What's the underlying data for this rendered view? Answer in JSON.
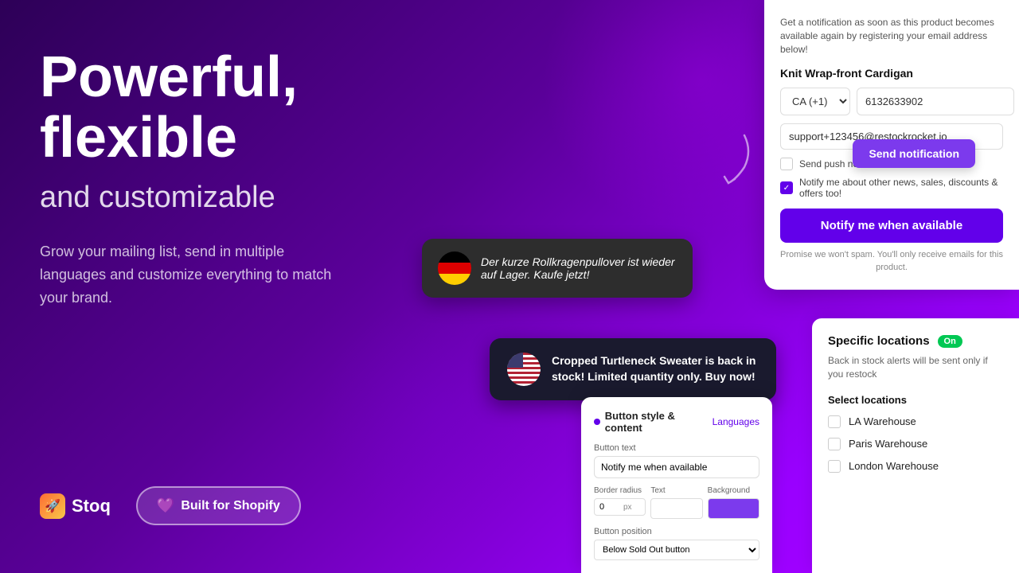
{
  "hero": {
    "title_line1": "Powerful,",
    "title_line2": "flexible",
    "subtitle": "and customizable",
    "description": "Grow your mailing list, send in multiple languages and customize everything to match your brand.",
    "stoq_label": "Stoq",
    "shopify_btn": "Built for Shopify"
  },
  "notification_form": {
    "description": "Get a notification as soon as this product becomes available again by registering your email address below!",
    "product_name": "Knit Wrap-front Cardigan",
    "phone_country": "CA (+1)",
    "phone_number": "6132633902",
    "email_placeholder": "support+123456@restockrocket.io",
    "push_notification_label": "Send push notification",
    "newsletter_label": "Notify me about other news, sales, discounts & offers too!",
    "notify_btn": "Notify me when available",
    "spam_text": "Promise we won't spam. You'll only receive emails for this product."
  },
  "send_notification_btn": "Send notification",
  "bubble_de": {
    "text": "Der kurze Rollkragenpullover ist wieder auf Lager. Kaufe jetzt!"
  },
  "bubble_en": {
    "text": "Cropped Turtleneck Sweater is back in stock! Limited quantity only. Buy now!"
  },
  "button_style_card": {
    "header": "Button style & content",
    "languages_link": "Languages",
    "button_text_label": "Button text",
    "button_text_value": "Notify me when available",
    "border_radius_label": "Border radius",
    "border_radius_value": "0",
    "border_radius_unit": "px",
    "text_label": "Text",
    "background_label": "Background",
    "button_position_label": "Button position",
    "button_position_value": "Below Sold Out button"
  },
  "locations_card": {
    "title": "Specific locations",
    "status": "On",
    "description": "Back in stock alerts will be sent only if you restock",
    "select_label": "Select locations",
    "locations": [
      {
        "name": "LA Warehouse"
      },
      {
        "name": "Paris Warehouse"
      },
      {
        "name": "London Warehouse"
      }
    ]
  },
  "colors": {
    "purple": "#6200ea",
    "light_purple": "#7c3aed",
    "green": "#00c853"
  }
}
